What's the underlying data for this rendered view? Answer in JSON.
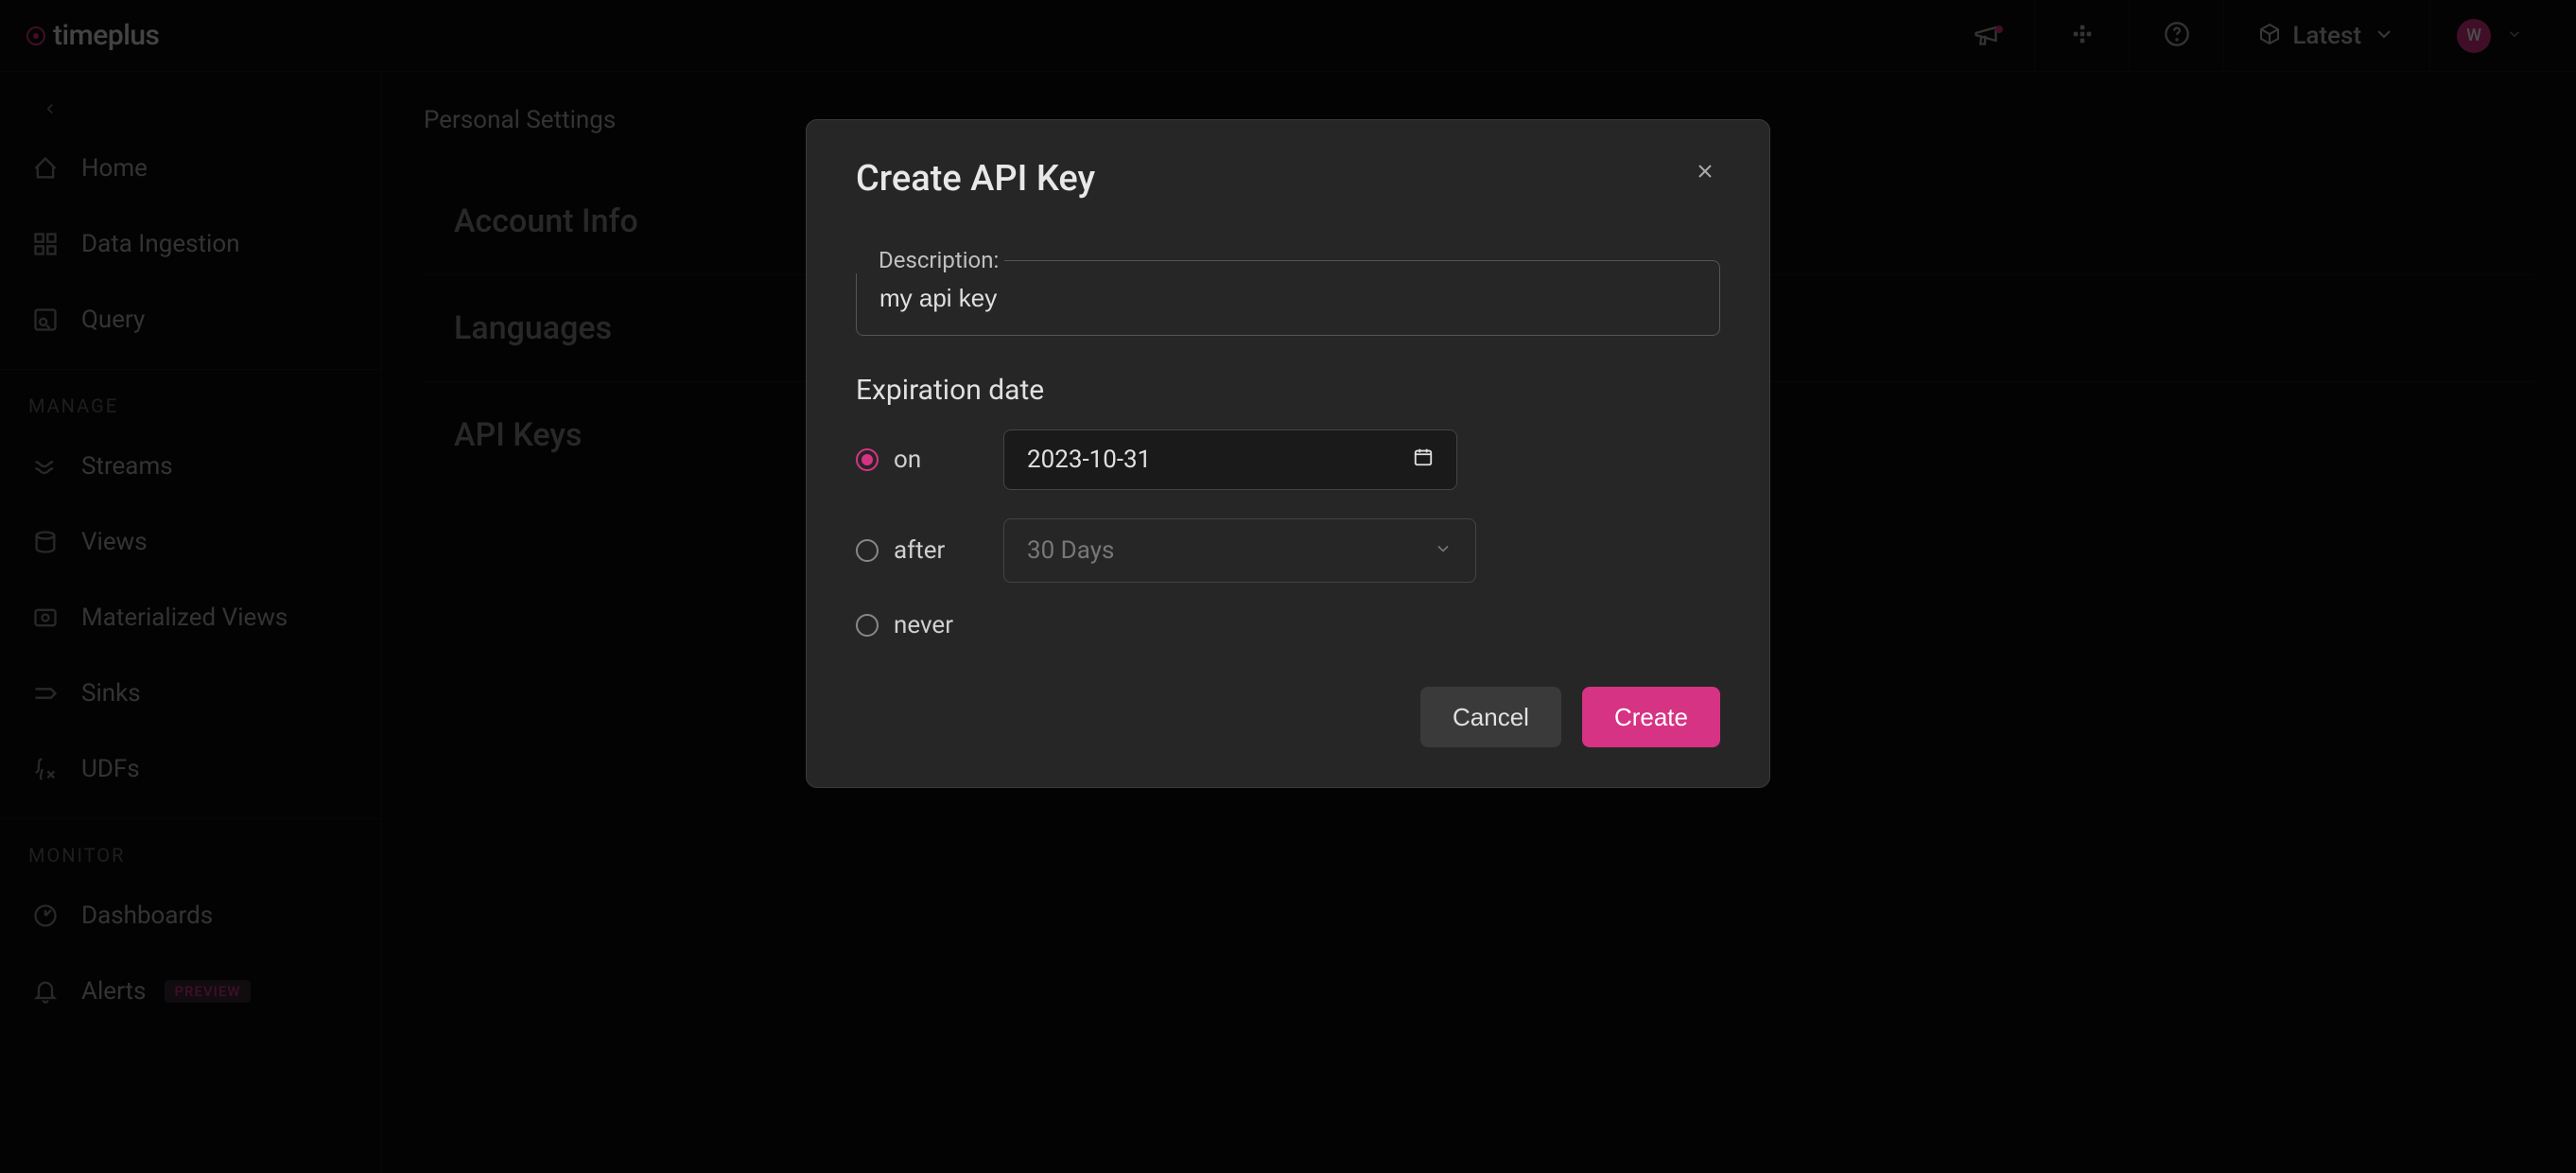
{
  "brand": "timeplus",
  "header": {
    "version_label": "Latest",
    "avatar_initial": "W"
  },
  "sidebar": {
    "home": "Home",
    "data_ingestion": "Data Ingestion",
    "query": "Query",
    "section_manage": "MANAGE",
    "streams": "Streams",
    "views": "Views",
    "materialized_views": "Materialized Views",
    "sinks": "Sinks",
    "udfs": "UDFs",
    "section_monitor": "MONITOR",
    "dashboards": "Dashboards",
    "alerts": "Alerts",
    "alerts_badge": "PREVIEW"
  },
  "main": {
    "page_title": "Personal Settings",
    "sections": {
      "account_info": "Account Info",
      "languages": "Languages",
      "api_keys": "API Keys"
    }
  },
  "modal": {
    "title": "Create API Key",
    "description_label": "Description:",
    "description_value": "my api key",
    "expiration_heading": "Expiration date",
    "options": {
      "on": "on",
      "after": "after",
      "never": "never"
    },
    "date_value": "2023-10-31",
    "after_select": "30 Days",
    "cancel": "Cancel",
    "create": "Create"
  }
}
